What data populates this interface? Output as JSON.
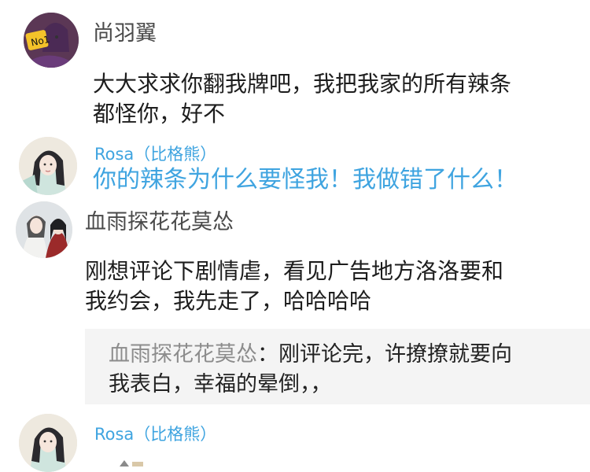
{
  "comments": [
    {
      "username": "尚羽翼",
      "text_line1": "大大求求你翻我牌吧，我把我家的所有辣条",
      "text_line2": "都怪你，好不"
    },
    {
      "username": "Rosa（比格熊）",
      "text": "你的辣条为什么要怪我！我做错了什么！"
    },
    {
      "username": "血雨探花花莫怂",
      "text_line1": "刚想评论下剧情虐，看见广告地方洛洛要和",
      "text_line2": "我约会，我先走了，哈哈哈哈",
      "quote": {
        "author": "血雨探花花莫怂",
        "separator": "：",
        "text_line1_rest": "刚评论完，许撩撩就要向",
        "text_line2": "我表白，幸福的晕倒，，"
      }
    },
    {
      "username": "Rosa（比格熊）"
    }
  ],
  "colors": {
    "author_blue": "#3fa4e0",
    "quote_background": "#f4f4f4",
    "quote_author": "#8c8c8c"
  }
}
